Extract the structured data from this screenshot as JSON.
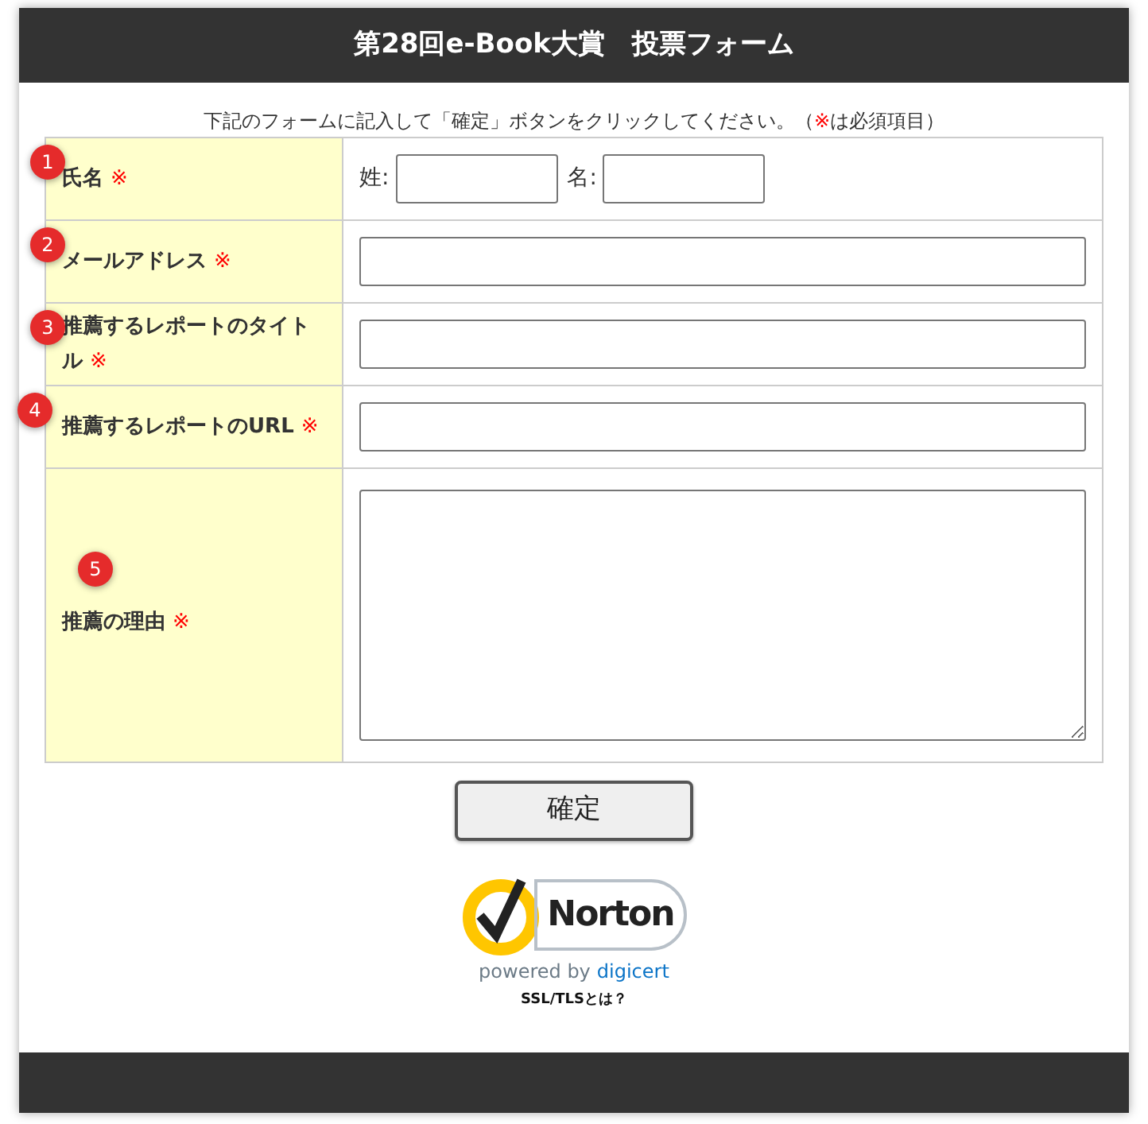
{
  "header": {
    "title": "第28回e-Book大賞　投票フォーム"
  },
  "instructions": {
    "before": "下記のフォームに記入して「確定」ボタンをクリックしてください。（",
    "mark": "※",
    "after": "は必須項目）"
  },
  "fields": [
    {
      "number": "1",
      "label": "氏名",
      "required_mark": "※",
      "kind": "name",
      "inputs": [
        {
          "label": "姓:"
        },
        {
          "label": "名:"
        }
      ]
    },
    {
      "number": "2",
      "label": "メールアドレス",
      "required_mark": "※",
      "kind": "text"
    },
    {
      "number": "3",
      "label": "推薦するレポートのタイトル",
      "required_mark": "※",
      "kind": "text"
    },
    {
      "number": "4",
      "label": "推薦するレポートのURL",
      "required_mark": "※",
      "kind": "text"
    },
    {
      "number": "5",
      "label": "推薦の理由",
      "required_mark": "※",
      "kind": "textarea"
    }
  ],
  "submit_button": "確定",
  "seal": {
    "brand": "Norton",
    "powered_by": "powered by",
    "partner": "digicert",
    "link": "SSL/TLSとは？"
  }
}
